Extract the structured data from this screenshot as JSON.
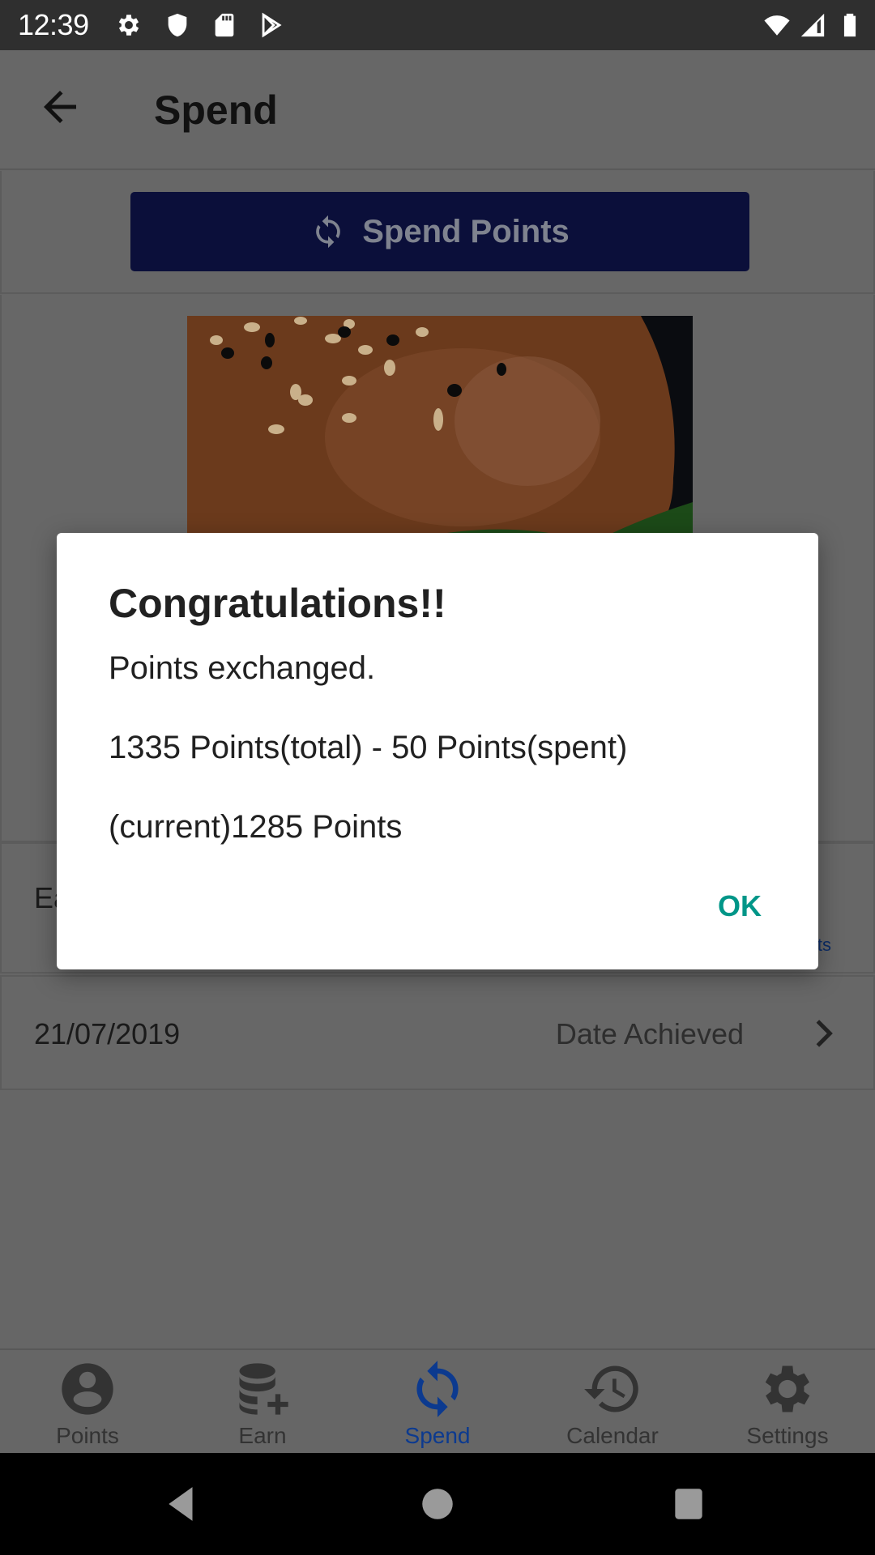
{
  "status_bar": {
    "time": "12:39",
    "left_icons": [
      "gear-icon",
      "shield-icon",
      "sd-card-icon",
      "play-store-icon"
    ],
    "right_icons": [
      "wifi-icon",
      "signal-icon",
      "battery-icon"
    ]
  },
  "app_bar": {
    "title": "Spend",
    "back_icon": "arrow-left-icon"
  },
  "spend_button": {
    "label": "Spend Points",
    "icon": "sync-icon"
  },
  "reward": {
    "image": "burger-photo"
  },
  "rows": {
    "earn_label_partial": "Ea",
    "earn_link_partial": "ts",
    "date_value": "21/07/2019",
    "date_label": "Date Achieved"
  },
  "dialog": {
    "title": "Congratulations!!",
    "line1": "Points exchanged.",
    "line2": "1335 Points(total) - 50 Points(spent)",
    "line3": "(current)1285 Points",
    "ok_label": "OK",
    "values": {
      "total": 1335,
      "spent": 50,
      "current": 1285
    }
  },
  "bottom_nav": {
    "items": [
      {
        "label": "Points",
        "icon": "account-circle-icon",
        "active": false
      },
      {
        "label": "Earn",
        "icon": "database-plus-icon",
        "active": false
      },
      {
        "label": "Spend",
        "icon": "sync-icon",
        "active": true
      },
      {
        "label": "Calendar",
        "icon": "history-icon",
        "active": false
      },
      {
        "label": "Settings",
        "icon": "gear-icon",
        "active": false
      }
    ]
  },
  "colors": {
    "accent_navy": "#0b0f3a",
    "nav_active": "#0c3a8f",
    "dialog_button": "#009688",
    "scrim": "#666666"
  }
}
